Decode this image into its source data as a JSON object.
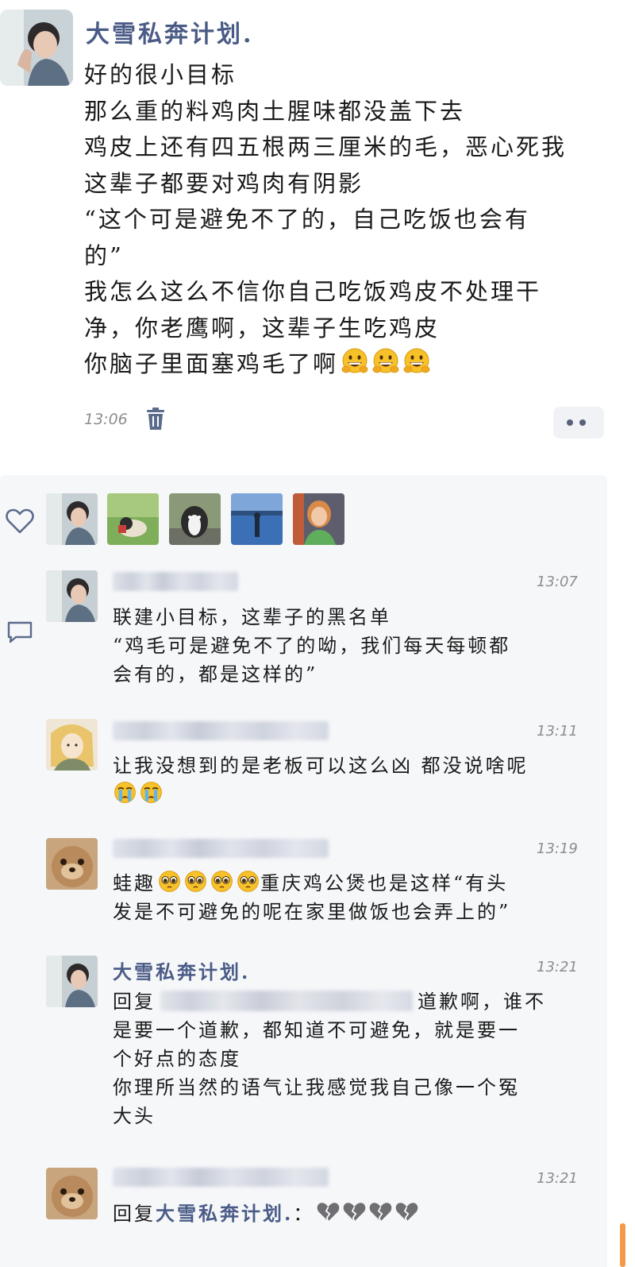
{
  "post": {
    "author": "大雪私奔计划.",
    "lines": [
      "好的很小目标",
      "那么重的料鸡肉土腥味都没盖下去",
      "鸡皮上还有四五根两三厘米的毛，恶心死我",
      "这辈子都要对鸡肉有阴影",
      "“这个可是避免不了的，自己吃饭也会有",
      "的”",
      "我怎么这么不信你自己吃饭鸡皮不处理干",
      "净，你老鹰啊，这辈子生吃鸡皮",
      "你脑子里面塞鸡毛了啊"
    ],
    "emoji_count": 3,
    "time": "13:06"
  },
  "comments": [
    {
      "time": "13:07",
      "lines": [
        "联建小目标，这辈子的黑名单",
        "“鸡毛可是避免不了的呦，我们每天每顿都",
        "会有的，都是这样的”"
      ]
    },
    {
      "time": "13:11",
      "lines": [
        "让我没想到的是老板可以这么凶 都没说啥呢"
      ]
    },
    {
      "time": "13:19",
      "prefix": "蛙趣",
      "rest": "重庆鸡公煲也是这样“有头",
      "line2": "发是不可避免的呢在家里做饭也会弄上的”"
    },
    {
      "author": "大雪私奔计划.",
      "time": "13:21",
      "reply_prefix": "回复",
      "reply_rest": "道歉啊，谁不",
      "lines": [
        "是要一个道歉，都知道不可避免，就是要一",
        "个好点的态度",
        "你理所当然的语气让我感觉我自己像一个冤",
        "大头"
      ]
    },
    {
      "time": "13:21",
      "reply_prefix": "回复",
      "reply_name": "大雪私奔计划.",
      "reply_colon": "："
    }
  ],
  "icons": {
    "trash": "trash-icon",
    "more": "more-dots-icon",
    "like": "heart-icon",
    "comment": "comment-icon"
  },
  "colors": {
    "author_name": "#4a5b86",
    "panel_bg": "#f6f7f9",
    "time": "#8d8d8d"
  }
}
